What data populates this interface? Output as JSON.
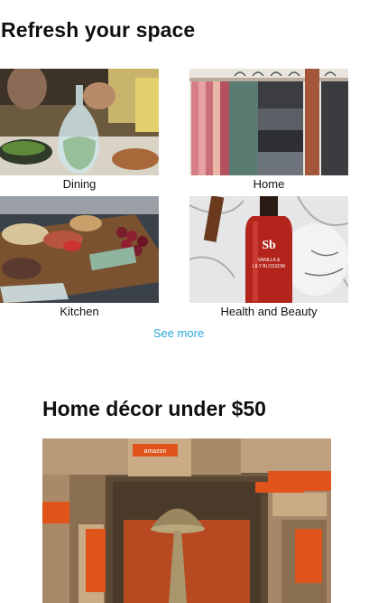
{
  "card_refresh": {
    "title": "Refresh your space",
    "tiles": [
      {
        "label": "Dining"
      },
      {
        "label": "Home"
      },
      {
        "label": "Kitchen"
      },
      {
        "label": "Health and Beauty"
      }
    ],
    "see_more": "See more"
  },
  "card_decor": {
    "title": "Home décor under $50"
  },
  "product_text": {
    "bottle_monogram": "Sb",
    "bottle_line1": "VANILLA &",
    "bottle_line2": "LILY BLOSSOM",
    "box_brand": "amazon"
  }
}
